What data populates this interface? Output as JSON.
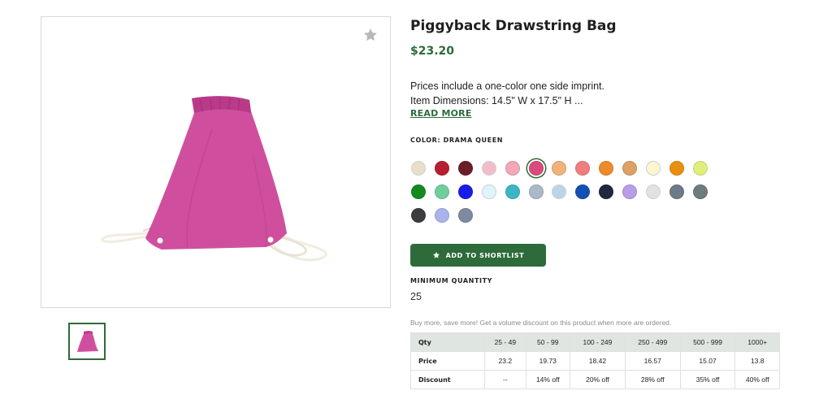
{
  "product": {
    "title": "Piggyback Drawstring Bag",
    "price": "$23.20",
    "description_lines": [
      "Prices include a one-color one side imprint.",
      "Item Dimensions: 14.5\" W x 17.5\" H ..."
    ],
    "read_more_label": "READ MORE",
    "image_icon": "drawstring-bag-pink",
    "favorite_icon": "star-icon"
  },
  "color": {
    "label": "COLOR: DRAMA QUEEN",
    "selected_index": 5,
    "swatches": [
      "#e8dfc8",
      "#b81f2e",
      "#6b1d28",
      "#f2bccb",
      "#f2a8b6",
      "#d94b7c",
      "#f0b27a",
      "#ef7f7f",
      "#ee8a2a",
      "#dda065",
      "#fdf6cf",
      "#e8900e",
      "#e2ee7c",
      "#168a1f",
      "#6fcf9c",
      "#1a1de8",
      "#dff4fb",
      "#3bb6c4",
      "#a9b9c6",
      "#bad4ea",
      "#1251b4",
      "#22263e",
      "#b79ee6",
      "#e2e2e2",
      "#6d7a8a",
      "#6e7c7e",
      "#3d3d3f",
      "#aab3ec",
      "#7d8aa2"
    ]
  },
  "actions": {
    "shortlist_label": "ADD TO SHORTLIST",
    "shortlist_icon": "star-icon"
  },
  "minimum_quantity": {
    "label": "MINIMUM QUANTITY",
    "value": "25"
  },
  "volume_note": "Buy more, save more! Get a volume discount on this product when more are ordered.",
  "pricing_table": {
    "header_label": "Qty",
    "price_label": "Price",
    "discount_label": "Discount",
    "columns": [
      {
        "qty": "25 - 49",
        "price": "23.2",
        "discount": "--"
      },
      {
        "qty": "50 - 99",
        "price": "19.73",
        "discount": "14% off"
      },
      {
        "qty": "100 - 249",
        "price": "18.42",
        "discount": "20% off"
      },
      {
        "qty": "250 - 499",
        "price": "16.57",
        "discount": "28% off"
      },
      {
        "qty": "500 - 999",
        "price": "15.07",
        "discount": "35% off"
      },
      {
        "qty": "1000+",
        "price": "13.8",
        "discount": "40% off"
      }
    ]
  },
  "colors": {
    "brand_green": "#2e6b3a",
    "bag_pink": "#cf4f9e"
  }
}
